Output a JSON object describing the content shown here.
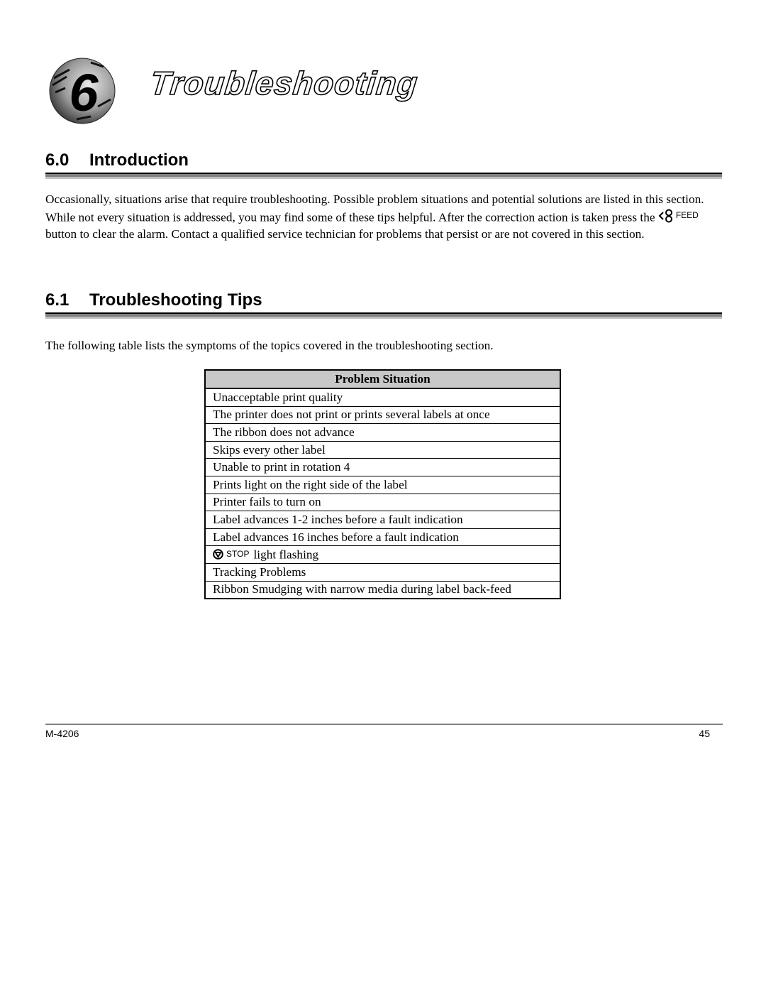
{
  "chapter": {
    "number": "6",
    "title": "Troubleshooting"
  },
  "sections": [
    {
      "number": "6.0",
      "title": "Introduction"
    },
    {
      "number": "6.1",
      "title": "Troubleshooting Tips"
    }
  ],
  "intro": {
    "text_before_button": "Occasionally, situations arise that require troubleshooting. Possible problem situations and potential solutions are listed in this section. While not every situation is addressed, you may find some of these tips helpful. After the correction action is taken press the ",
    "button_icon": "feed-icon",
    "button_label": "FEED",
    "text_after_button": " button to clear the alarm. Contact a qualified service technician for problems that persist or are not covered in this section."
  },
  "tips_intro": "The following table lists the symptoms of the topics covered in the troubleshooting section.",
  "table": {
    "header": "Problem Situation",
    "rows": [
      "Unacceptable print quality",
      "The printer does not print or prints several labels at once",
      "The ribbon does not advance",
      "Skips every other label",
      "Unable to print in rotation 4",
      "Prints light on the right side of the label",
      "Printer fails to turn on",
      "Label advances 1-2 inches before a fault indication",
      "Label advances 16 inches before a fault indication",
      "light flashing",
      "Tracking Problems",
      "Ribbon Smudging with narrow media during label back-feed"
    ],
    "stop_row": {
      "icon": "stop-icon",
      "label": "STOP"
    }
  },
  "footer": {
    "doc_number": "M-4206",
    "page_number": "45"
  }
}
